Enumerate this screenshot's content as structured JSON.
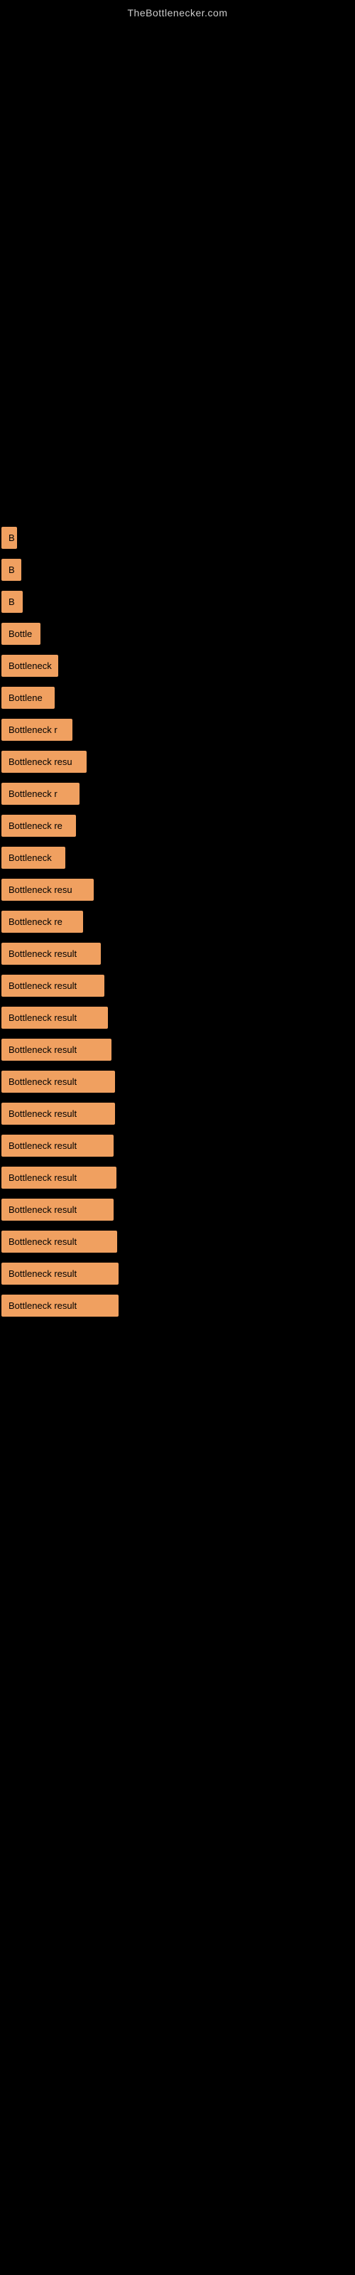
{
  "site": {
    "title": "TheBottlenecker.com"
  },
  "results": [
    {
      "id": 1,
      "label": "B",
      "width_class": "w1"
    },
    {
      "id": 2,
      "label": "B",
      "width_class": "w2"
    },
    {
      "id": 3,
      "label": "B",
      "width_class": "w3"
    },
    {
      "id": 4,
      "label": "Bottle",
      "width_class": "w4"
    },
    {
      "id": 5,
      "label": "Bottleneck",
      "width_class": "w5"
    },
    {
      "id": 6,
      "label": "Bottlene",
      "width_class": "w6"
    },
    {
      "id": 7,
      "label": "Bottleneck r",
      "width_class": "w7"
    },
    {
      "id": 8,
      "label": "Bottleneck resu",
      "width_class": "w8"
    },
    {
      "id": 9,
      "label": "Bottleneck r",
      "width_class": "w9"
    },
    {
      "id": 10,
      "label": "Bottleneck re",
      "width_class": "w10"
    },
    {
      "id": 11,
      "label": "Bottleneck",
      "width_class": "w11"
    },
    {
      "id": 12,
      "label": "Bottleneck resu",
      "width_class": "w12"
    },
    {
      "id": 13,
      "label": "Bottleneck re",
      "width_class": "w13"
    },
    {
      "id": 14,
      "label": "Bottleneck result",
      "width_class": "w14"
    },
    {
      "id": 15,
      "label": "Bottleneck result",
      "width_class": "w15"
    },
    {
      "id": 16,
      "label": "Bottleneck result",
      "width_class": "w16"
    },
    {
      "id": 17,
      "label": "Bottleneck result",
      "width_class": "w17"
    },
    {
      "id": 18,
      "label": "Bottleneck result",
      "width_class": "w18"
    },
    {
      "id": 19,
      "label": "Bottleneck result",
      "width_class": "w18"
    },
    {
      "id": 20,
      "label": "Bottleneck result",
      "width_class": "w19"
    },
    {
      "id": 21,
      "label": "Bottleneck result",
      "width_class": "w20"
    },
    {
      "id": 22,
      "label": "Bottleneck result",
      "width_class": "w19"
    },
    {
      "id": 23,
      "label": "Bottleneck result",
      "width_class": "w21"
    },
    {
      "id": 24,
      "label": "Bottleneck result",
      "width_class": "w22"
    },
    {
      "id": 25,
      "label": "Bottleneck result",
      "width_class": "w22"
    }
  ]
}
